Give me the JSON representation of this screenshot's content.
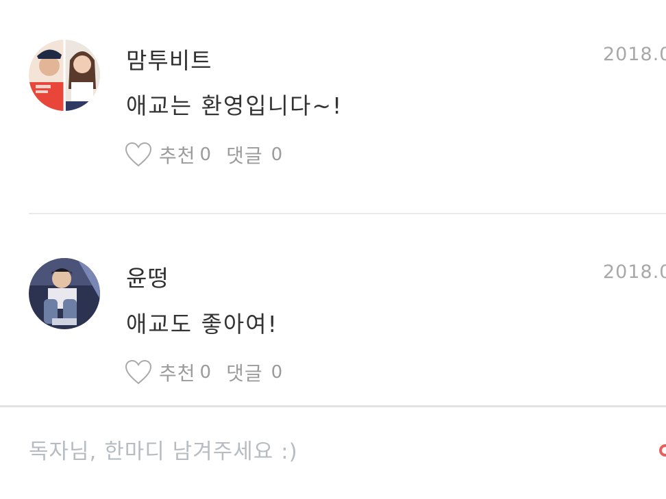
{
  "comments": [
    {
      "nickname": "맘투비트",
      "date": "2018.0",
      "text": "애교는 환영입니다~!",
      "like_label": "추천",
      "like_count": "0",
      "reply_label": "댓글",
      "reply_count": "0",
      "avatar": "two-person-photo"
    },
    {
      "nickname": "윤떵",
      "date": "2018.0",
      "text": "애교도 좋아여!",
      "like_label": "추천",
      "like_count": "0",
      "reply_label": "댓글",
      "reply_count": "0",
      "avatar": "person-photo"
    }
  ],
  "input": {
    "placeholder": "독자님, 한마디 남겨주세요 :)",
    "value": ""
  },
  "icons": {
    "like": "heart-outline-icon",
    "submit": "submit-icon"
  },
  "colors": {
    "nickname": "#2f2f2f",
    "meta": "#9b9b9b",
    "placeholder": "#b6bcc2",
    "accent": "#e8605c",
    "divider": "#e9e9e9"
  }
}
